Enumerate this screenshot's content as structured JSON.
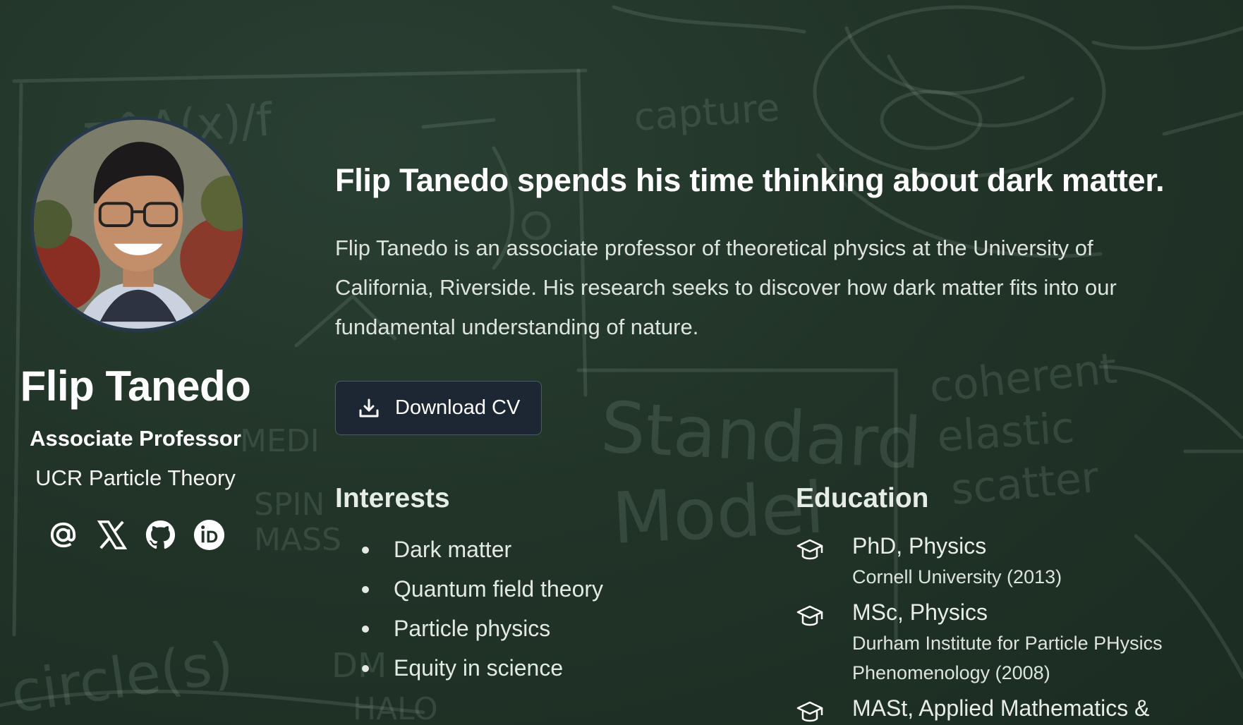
{
  "profile": {
    "name": "Flip Tanedo",
    "role": "Associate Professor",
    "organization": "UCR Particle Theory",
    "socials": [
      {
        "icon": "at-sign-icon"
      },
      {
        "icon": "x-twitter-icon"
      },
      {
        "icon": "github-icon"
      },
      {
        "icon": "orcid-icon"
      }
    ]
  },
  "main": {
    "headline": "Flip Tanedo spends his time thinking about dark matter.",
    "bio": "Flip Tanedo is an associate professor of theoretical physics at the University of California, Riverside. His research seeks to discover how dark matter fits into our fundamental understanding of nature.",
    "cv_button": {
      "label": "Download CV",
      "icon": "download-icon"
    }
  },
  "interests": {
    "title": "Interests",
    "items": [
      "Dark matter",
      "Quantum field theory",
      "Particle physics",
      "Equity in science"
    ]
  },
  "education": {
    "title": "Education",
    "items": [
      {
        "degree": "PhD, Physics",
        "institution": "Cornell University (2013)",
        "icon": "graduation-cap-icon"
      },
      {
        "degree": "MSc, Physics",
        "institution": "Durham Institute for Particle PHysics Phenomenology (2008)",
        "icon": "graduation-cap-icon"
      },
      {
        "degree": "MASt, Applied Mathematics &",
        "institution": "",
        "icon": "graduation-cap-icon"
      }
    ]
  },
  "chalkboard": {
    "words": [
      "capture",
      "Standard",
      "Model",
      "coherent",
      "elastic",
      "scatter",
      "π^A(x)/f",
      "MEDI",
      "SPIN",
      "MASS",
      "DM",
      "circle(s)",
      "HALO"
    ]
  },
  "colors": {
    "background": "#203429",
    "button_bg": "#1c2733",
    "text": "#ffffff"
  }
}
